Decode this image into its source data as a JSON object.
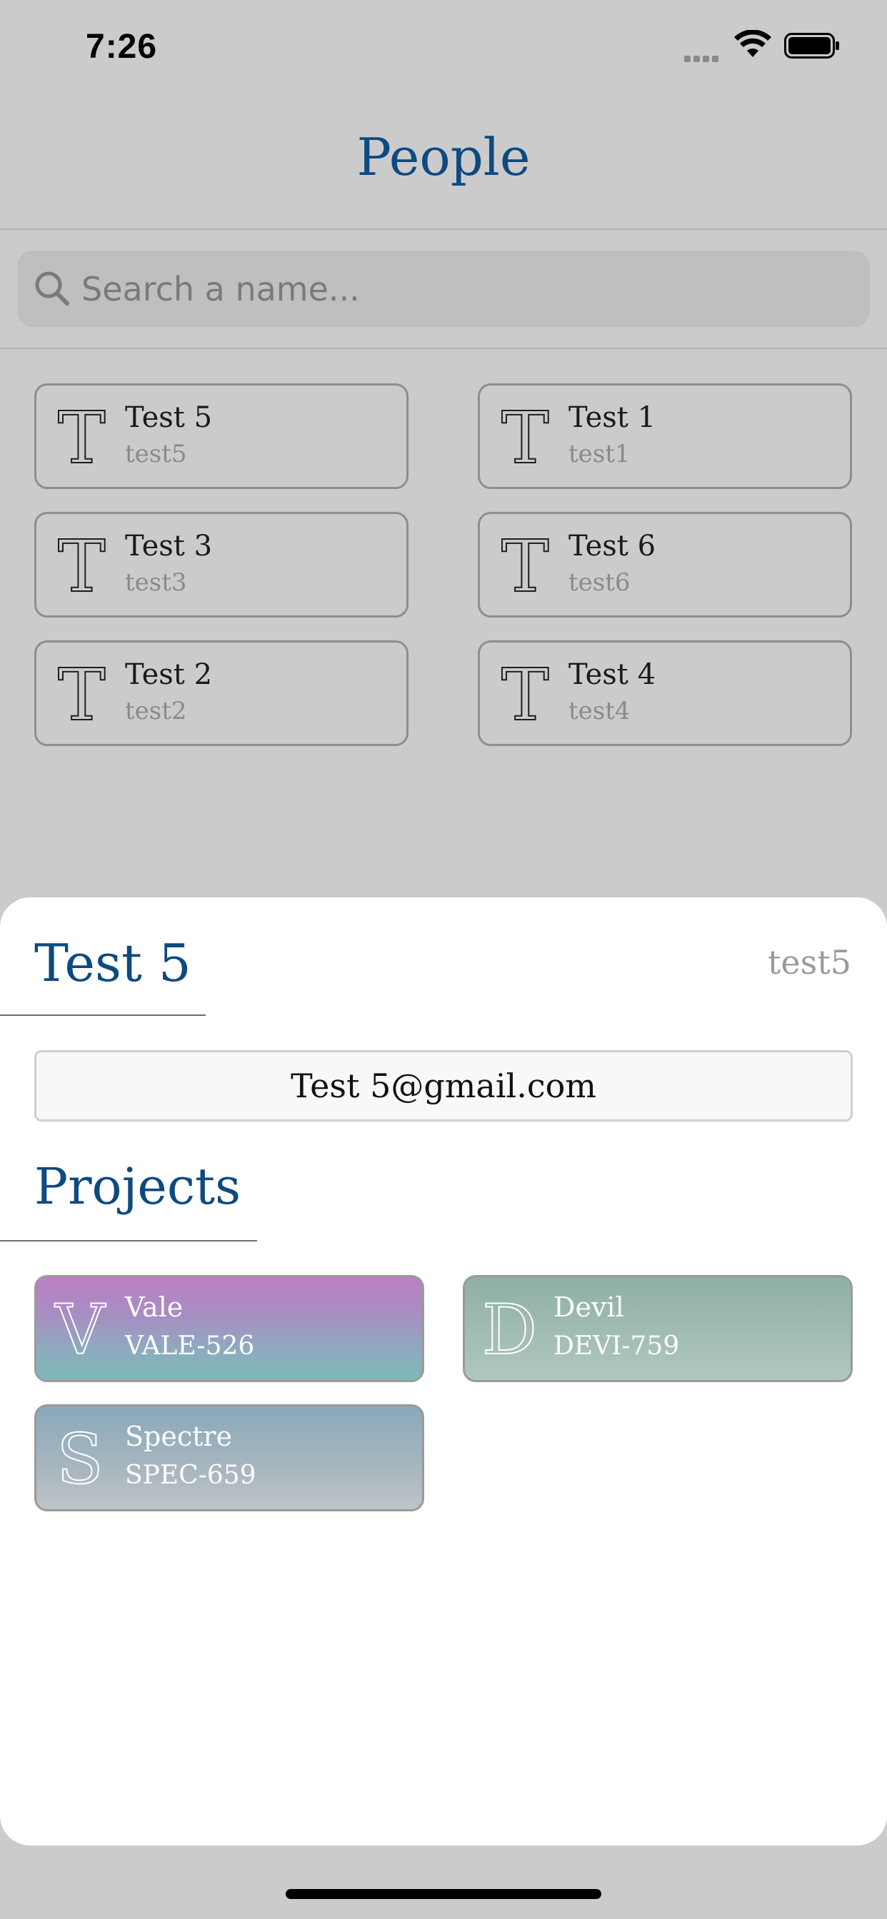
{
  "status_bar": {
    "time": "7:26"
  },
  "header": {
    "title": "People"
  },
  "search": {
    "placeholder": "Search a name..."
  },
  "people": [
    {
      "letter": "T",
      "name": "Test 5",
      "handle": "test5"
    },
    {
      "letter": "T",
      "name": "Test 1",
      "handle": "test1"
    },
    {
      "letter": "T",
      "name": "Test 3",
      "handle": "test3"
    },
    {
      "letter": "T",
      "name": "Test 6",
      "handle": "test6"
    },
    {
      "letter": "T",
      "name": "Test 2",
      "handle": "test2"
    },
    {
      "letter": "T",
      "name": "Test 4",
      "handle": "test4"
    }
  ],
  "detail": {
    "name": "Test 5",
    "handle": "test5",
    "email": "Test 5@gmail.com",
    "projects_title": "Projects",
    "projects": [
      {
        "letter": "V",
        "name": "Vale",
        "code": "VALE-526"
      },
      {
        "letter": "D",
        "name": "Devil",
        "code": "DEVI-759"
      },
      {
        "letter": "S",
        "name": "Spectre",
        "code": "SPEC-659"
      }
    ]
  },
  "colors": {
    "accent": "#0d4a80",
    "dim_background": "#cbcbcb",
    "sheet_background": "#ffffff"
  },
  "icons": {
    "search": "search-icon",
    "wifi": "wifi-icon",
    "battery": "battery-icon",
    "signal": "cellular-signal-icon"
  }
}
